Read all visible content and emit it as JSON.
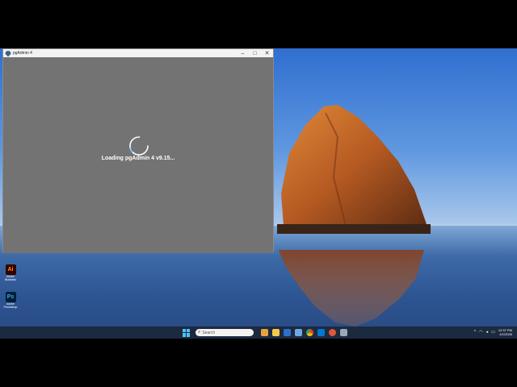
{
  "window": {
    "title": "pgAdmin 4",
    "minimize": "–",
    "maximize": "□",
    "close": "✕",
    "loading_text": "Loading pgAdmin 4 v9.15..."
  },
  "desktop": {
    "icons": [
      {
        "glyph": "Ai",
        "label": "Adobe Illustrator",
        "color": "#ff9a00",
        "bg": "#330000"
      },
      {
        "glyph": "Ps",
        "label": "Adobe Photoshop",
        "color": "#31a8ff",
        "bg": "#001e36"
      }
    ]
  },
  "taskbar": {
    "search_placeholder": "Search",
    "clock_time": "12:37 PM",
    "clock_date": "4/1/2026",
    "tray_chevron": "^"
  },
  "colors": {
    "taskbar_bg": "#1c2a3f",
    "window_bg": "#737373",
    "accent": "#4cc2ff"
  }
}
